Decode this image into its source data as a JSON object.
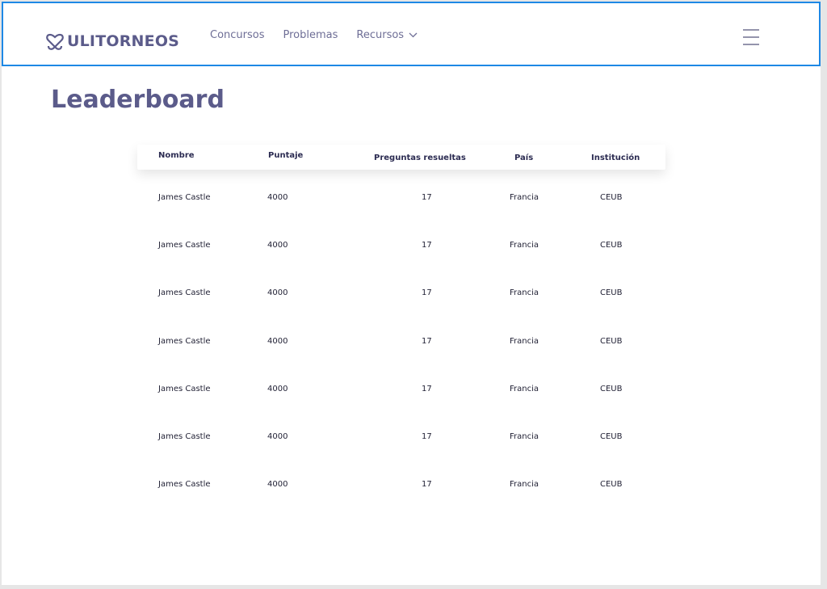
{
  "brand": {
    "name": "ULITORNEOS",
    "color": "#5b5b8a"
  },
  "nav": {
    "items": [
      {
        "label": "Concursos"
      },
      {
        "label": "Problemas"
      },
      {
        "label": "Recursos"
      }
    ]
  },
  "page": {
    "title": "Leaderboard"
  },
  "table": {
    "columns": [
      "Nombre",
      "Puntaje",
      "Preguntas resueltas",
      "País",
      "Institución"
    ],
    "rows": [
      [
        "James Castle",
        "4000",
        "17",
        "Francia",
        "CEUB"
      ],
      [
        "James Castle",
        "4000",
        "17",
        "Francia",
        "CEUB"
      ],
      [
        "James Castle",
        "4000",
        "17",
        "Francia",
        "CEUB"
      ],
      [
        "James Castle",
        "4000",
        "17",
        "Francia",
        "CEUB"
      ],
      [
        "James Castle",
        "4000",
        "17",
        "Francia",
        "CEUB"
      ],
      [
        "James Castle",
        "4000",
        "17",
        "Francia",
        "CEUB"
      ],
      [
        "James Castle",
        "4000",
        "17",
        "Francia",
        "CEUB"
      ]
    ]
  },
  "icons": {
    "logo": "logo-knot-icon",
    "dropdown": "chevron-down-icon",
    "menu": "hamburger-menu-icon"
  },
  "colors": {
    "accent_border": "#1e88e5",
    "nav_text": "#6e6e96"
  }
}
